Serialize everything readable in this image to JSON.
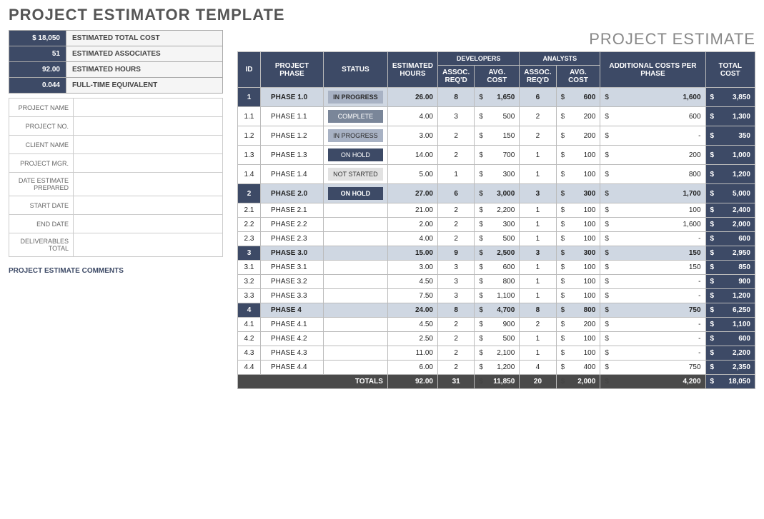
{
  "title": "PROJECT ESTIMATOR TEMPLATE",
  "estimate_title": "PROJECT ESTIMATE",
  "summary": [
    {
      "value": "$     18,050",
      "label": "ESTIMATED TOTAL COST"
    },
    {
      "value": "51",
      "label": "ESTIMATED ASSOCIATES"
    },
    {
      "value": "92.00",
      "label": "ESTIMATED HOURS"
    },
    {
      "value": "0.044",
      "label": "FULL-TIME EQUIVALENT"
    }
  ],
  "meta_fields": [
    "PROJECT NAME",
    "PROJECT NO.",
    "CLIENT NAME",
    "PROJECT MGR.",
    "DATE ESTIMATE PREPARED",
    "START DATE",
    "END DATE",
    "DELIVERABLES TOTAL"
  ],
  "comments_label": "PROJECT ESTIMATE COMMENTS",
  "headers": {
    "id": "ID",
    "phase": "PROJECT PHASE",
    "status": "STATUS",
    "est_hours": "ESTIMATED HOURS",
    "developers": "DEVELOPERS",
    "analysts": "ANALYSTS",
    "assoc": "ASSOC. REQ'D",
    "avg_cost": "AVG. COST",
    "additional": "ADDITIONAL COSTS PER PHASE",
    "total_cost": "TOTAL COST",
    "totals": "TOTALS"
  },
  "status_labels": {
    "inprogress": "IN PROGRESS",
    "complete": "COMPLETE",
    "onhold": "ON HOLD",
    "notstarted": "NOT STARTED"
  },
  "rows": [
    {
      "type": "parent",
      "id": "1",
      "phase": "PHASE 1.0",
      "status": "inprogress",
      "hours": "26.00",
      "dev_assoc": "8",
      "dev_cost": "1,650",
      "an_assoc": "6",
      "an_cost": "600",
      "add": "1,600",
      "total": "3,850"
    },
    {
      "type": "child",
      "id": "1.1",
      "phase": "PHASE 1.1",
      "status": "complete",
      "hours": "4.00",
      "dev_assoc": "3",
      "dev_cost": "500",
      "an_assoc": "2",
      "an_cost": "200",
      "add": "600",
      "total": "1,300"
    },
    {
      "type": "child",
      "id": "1.2",
      "phase": "PHASE 1.2",
      "status": "inprogress",
      "hours": "3.00",
      "dev_assoc": "2",
      "dev_cost": "150",
      "an_assoc": "2",
      "an_cost": "200",
      "add": "-",
      "total": "350"
    },
    {
      "type": "child",
      "id": "1.3",
      "phase": "PHASE 1.3",
      "status": "onhold",
      "hours": "14.00",
      "dev_assoc": "2",
      "dev_cost": "700",
      "an_assoc": "1",
      "an_cost": "100",
      "add": "200",
      "total": "1,000"
    },
    {
      "type": "child",
      "id": "1.4",
      "phase": "PHASE 1.4",
      "status": "notstarted",
      "hours": "5.00",
      "dev_assoc": "1",
      "dev_cost": "300",
      "an_assoc": "1",
      "an_cost": "100",
      "add": "800",
      "total": "1,200"
    },
    {
      "type": "parent",
      "id": "2",
      "phase": "PHASE 2.0",
      "status": "onhold",
      "hours": "27.00",
      "dev_assoc": "6",
      "dev_cost": "3,000",
      "an_assoc": "3",
      "an_cost": "300",
      "add": "1,700",
      "total": "5,000"
    },
    {
      "type": "child",
      "id": "2.1",
      "phase": "PHASE 2.1",
      "status": "",
      "hours": "21.00",
      "dev_assoc": "2",
      "dev_cost": "2,200",
      "an_assoc": "1",
      "an_cost": "100",
      "add": "100",
      "total": "2,400"
    },
    {
      "type": "child",
      "id": "2.2",
      "phase": "PHASE 2.2",
      "status": "",
      "hours": "2.00",
      "dev_assoc": "2",
      "dev_cost": "300",
      "an_assoc": "1",
      "an_cost": "100",
      "add": "1,600",
      "total": "2,000"
    },
    {
      "type": "child",
      "id": "2.3",
      "phase": "PHASE 2.3",
      "status": "",
      "hours": "4.00",
      "dev_assoc": "2",
      "dev_cost": "500",
      "an_assoc": "1",
      "an_cost": "100",
      "add": "-",
      "total": "600"
    },
    {
      "type": "parent",
      "id": "3",
      "phase": "PHASE 3.0",
      "status": "",
      "hours": "15.00",
      "dev_assoc": "9",
      "dev_cost": "2,500",
      "an_assoc": "3",
      "an_cost": "300",
      "add": "150",
      "total": "2,950"
    },
    {
      "type": "child",
      "id": "3.1",
      "phase": "PHASE 3.1",
      "status": "",
      "hours": "3.00",
      "dev_assoc": "3",
      "dev_cost": "600",
      "an_assoc": "1",
      "an_cost": "100",
      "add": "150",
      "total": "850"
    },
    {
      "type": "child",
      "id": "3.2",
      "phase": "PHASE 3.2",
      "status": "",
      "hours": "4.50",
      "dev_assoc": "3",
      "dev_cost": "800",
      "an_assoc": "1",
      "an_cost": "100",
      "add": "-",
      "total": "900"
    },
    {
      "type": "child",
      "id": "3.3",
      "phase": "PHASE 3.3",
      "status": "",
      "hours": "7.50",
      "dev_assoc": "3",
      "dev_cost": "1,100",
      "an_assoc": "1",
      "an_cost": "100",
      "add": "-",
      "total": "1,200"
    },
    {
      "type": "parent",
      "id": "4",
      "phase": "PHASE 4",
      "status": "",
      "hours": "24.00",
      "dev_assoc": "8",
      "dev_cost": "4,700",
      "an_assoc": "8",
      "an_cost": "800",
      "add": "750",
      "total": "6,250"
    },
    {
      "type": "child",
      "id": "4.1",
      "phase": "PHASE 4.1",
      "status": "",
      "hours": "4.50",
      "dev_assoc": "2",
      "dev_cost": "900",
      "an_assoc": "2",
      "an_cost": "200",
      "add": "-",
      "total": "1,100"
    },
    {
      "type": "child",
      "id": "4.2",
      "phase": "PHASE 4.2",
      "status": "",
      "hours": "2.50",
      "dev_assoc": "2",
      "dev_cost": "500",
      "an_assoc": "1",
      "an_cost": "100",
      "add": "-",
      "total": "600"
    },
    {
      "type": "child",
      "id": "4.3",
      "phase": "PHASE 4.3",
      "status": "",
      "hours": "11.00",
      "dev_assoc": "2",
      "dev_cost": "2,100",
      "an_assoc": "1",
      "an_cost": "100",
      "add": "-",
      "total": "2,200"
    },
    {
      "type": "child",
      "id": "4.4",
      "phase": "PHASE 4.4",
      "status": "",
      "hours": "6.00",
      "dev_assoc": "2",
      "dev_cost": "1,200",
      "an_assoc": "4",
      "an_cost": "400",
      "add": "750",
      "total": "2,350"
    }
  ],
  "totals": {
    "hours": "92.00",
    "dev_assoc": "31",
    "dev_cost": "11,850",
    "an_assoc": "20",
    "an_cost": "2,000",
    "add": "4,200",
    "total": "18,050"
  }
}
